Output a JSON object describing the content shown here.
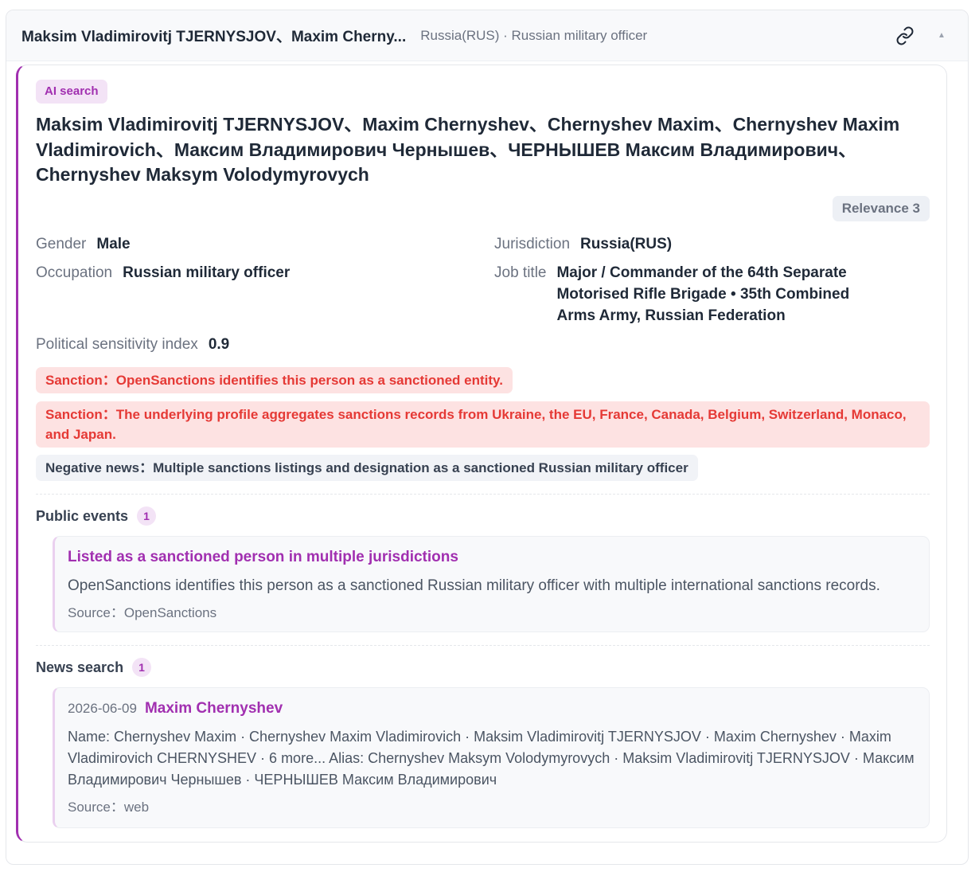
{
  "header": {
    "title": "Maksim Vladimirovitj TJERNYSJOV、Maxim Cherny...",
    "subtitle": "Russia(RUS) · Russian military officer",
    "link_icon": "link-icon",
    "collapse_icon": "collapse-caret-icon"
  },
  "profile": {
    "badge": "AI search",
    "name": "Maksim Vladimirovitj TJERNYSJOV、Maxim Chernyshev、Chernyshev Maxim、Chernyshev Maxim Vladimirovich、Максим Владимирович Чернышев、ЧЕРНЫШЕВ Максим Владимирович、Chernyshev Maksym Volodymyrovych",
    "relevance": "Relevance 3",
    "gender_label": "Gender",
    "gender_value": "Male",
    "jurisdiction_label": "Jurisdiction",
    "jurisdiction_value": "Russia(RUS)",
    "occupation_label": "Occupation",
    "occupation_value": "Russian military officer",
    "job_title_label": "Job title",
    "job_title_value": "Major / Commander of the 64th Separate Motorised Rifle Brigade • 35th Combined Arms Army, Russian Federation",
    "psi_label": "Political sensitivity index",
    "psi_value": "0.9"
  },
  "tags": [
    "Sanction：OpenSanctions identifies this person as a sanctioned entity.",
    "Sanction：The underlying profile aggregates sanctions records from Ukraine, the EU, France, Canada, Belgium, Switzerland, Monaco, and Japan.",
    "Negative news：Multiple sanctions listings and designation as a sanctioned Russian military officer"
  ],
  "public_events": {
    "label": "Public events",
    "count": "1",
    "items": [
      {
        "title": "Listed as a sanctioned person in multiple jurisdictions",
        "description": "OpenSanctions identifies this person as a sanctioned Russian military officer with multiple international sanctions records.",
        "source": "Source：OpenSanctions"
      }
    ]
  },
  "news_search": {
    "label": "News search",
    "count": "1",
    "items": [
      {
        "date": "2026-06-09",
        "title": "Maxim Chernyshev",
        "body": "Name: Chernyshev Maxim · Chernyshev Maxim Vladimirovich · Maksim Vladimirovitj TJERNYSJOV · Maxim Chernyshev · Maxim Vladimirovich CHERNYSHEV · 6 more... Alias: Chernyshev Maksym Volodymyrovych · Maksim Vladimirovitj TJERNYSJOV · Максим Владимирович Чернышев · ЧЕРНЫШЕВ Максим Владимирович",
        "source": "Source：web"
      }
    ]
  },
  "colors": {
    "accent": "#a12fb0",
    "sanction_bg": "#fde2e2",
    "sanction_text": "#e53935"
  }
}
